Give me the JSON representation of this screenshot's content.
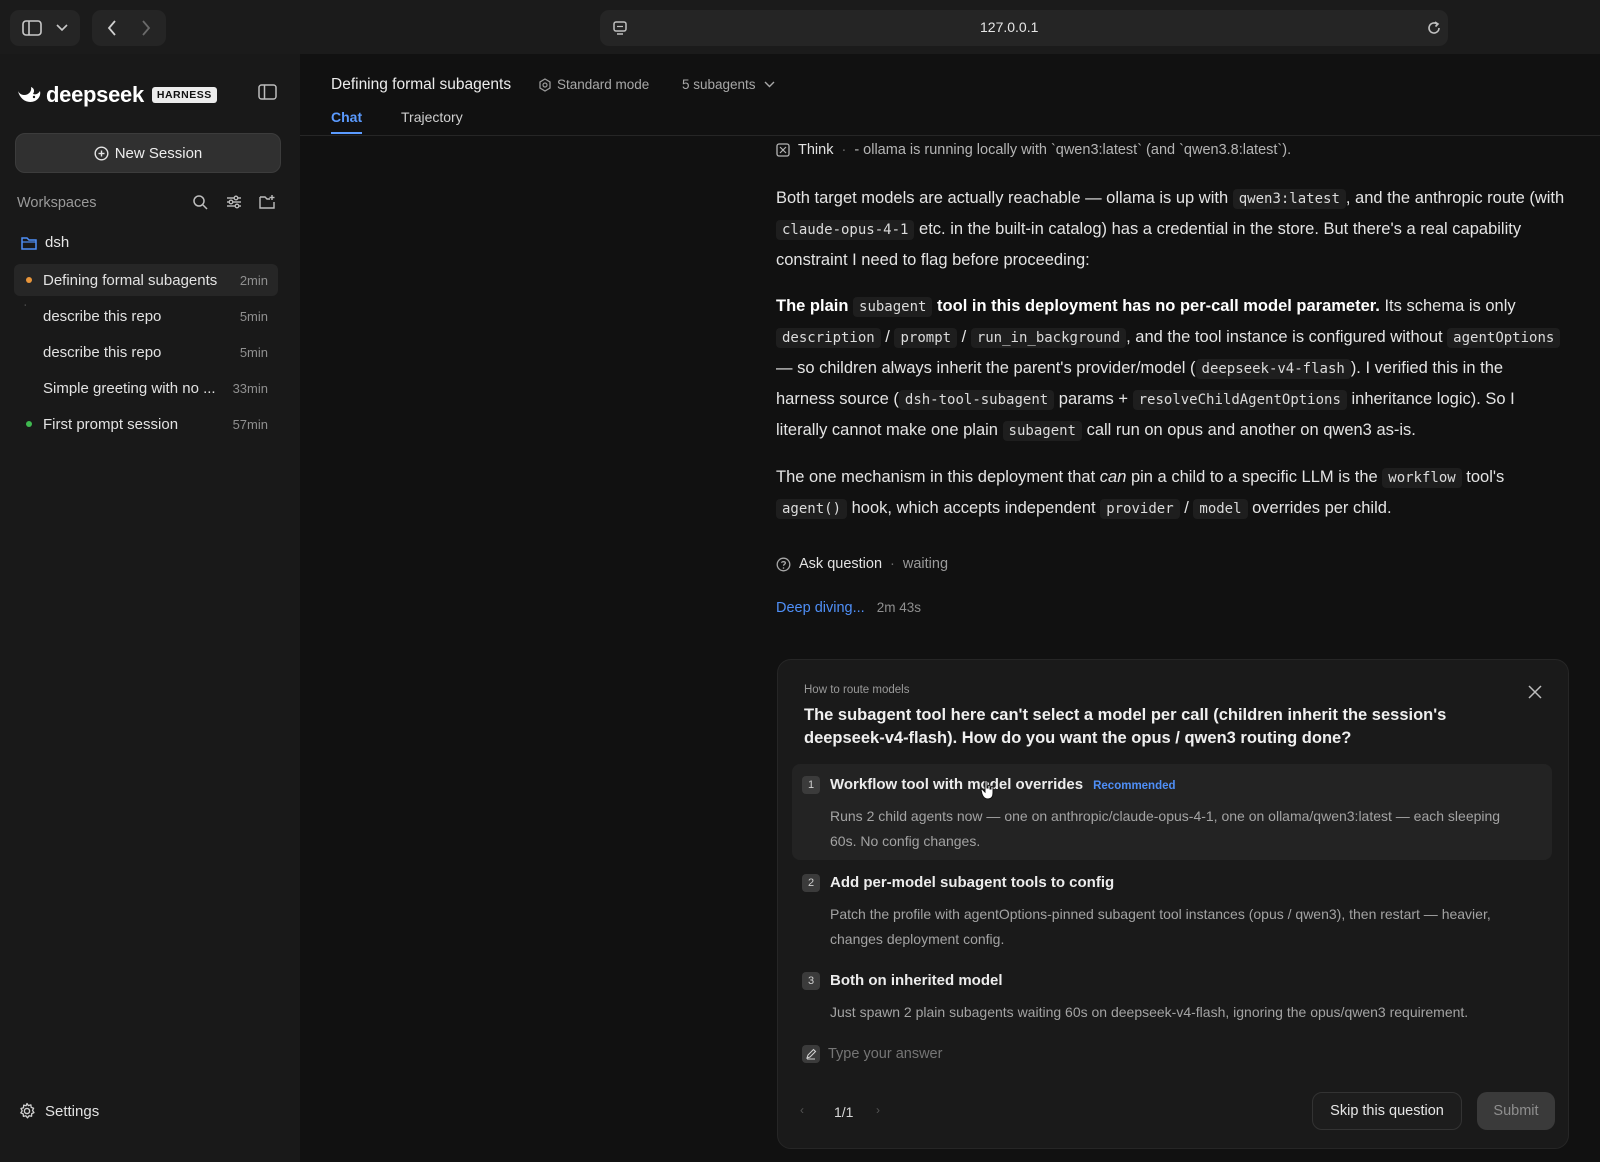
{
  "browser": {
    "url": "127.0.0.1"
  },
  "sidebar": {
    "brand": "deepseek",
    "badge": "HARNESS",
    "new_session": "New Session",
    "workspaces_label": "Workspaces",
    "workspace": "dsh",
    "sessions": [
      {
        "label": "Defining formal subagents",
        "time": "2min",
        "status": "running",
        "active": true
      },
      {
        "label": "describe this repo",
        "time": "5min",
        "status": "idle-mark",
        "active": false
      },
      {
        "label": "describe this repo",
        "time": "5min",
        "status": "none",
        "active": false
      },
      {
        "label": "Simple greeting with no ...",
        "time": "33min",
        "status": "none",
        "active": false
      },
      {
        "label": "First prompt session",
        "time": "57min",
        "status": "done",
        "active": false
      }
    ],
    "settings": "Settings"
  },
  "header": {
    "title": "Defining formal subagents",
    "mode": "Standard mode",
    "subagents": "5 subagents",
    "tabs": [
      "Chat",
      "Trajectory"
    ],
    "active_tab": "Chat"
  },
  "chat": {
    "think": {
      "label": "Think",
      "sep": "·",
      "text": "- ollama is running locally with `qwen3:latest` (and `qwen3.8:latest`)."
    },
    "p1": {
      "t1": "Both target models are actually reachable — ollama is up with ",
      "c1": "qwen3:latest",
      "t2": ", and the anthropic route (with ",
      "c2": "claude-opus-4-1",
      "t3": " etc. in the built-in catalog) has a credential in the store. But there's a real capability constraint I need to flag before proceeding:"
    },
    "p2": {
      "b1": "The plain ",
      "c1": "subagent",
      "b2": " tool in this deployment has no per-call model parameter.",
      "t1": " Its schema is only ",
      "c2": "description",
      "s1": " / ",
      "c3": "prompt",
      "s2": " / ",
      "c4": "run_in_background",
      "t2": ", and the tool instance is configured without ",
      "c5": "agentOptions",
      "t3": " — so children always inherit the parent's provider/model (",
      "c6": "deepseek-v4-flash",
      "t4": "). I verified this in the harness source (",
      "c7": "dsh-tool-subagent",
      "t5": " params + ",
      "c8": "resolveChildAgentOptions",
      "t6": " inheritance logic). So I literally cannot make one plain ",
      "c9": "subagent",
      "t7": " call run on opus and another on qwen3 as-is."
    },
    "p3": {
      "t1": "The one mechanism in this deployment that ",
      "i1": "can",
      "t2": " pin a child to a specific LLM is the ",
      "c1": "workflow",
      "t3": " tool's ",
      "c2": "agent()",
      "t4": " hook, which accepts independent ",
      "c3": "provider",
      "s1": " / ",
      "c4": "model",
      "t5": " overrides per child."
    },
    "ask": {
      "label": "Ask question",
      "sep": "·",
      "status": "waiting"
    },
    "progress": {
      "label": "Deep diving...",
      "elapsed": "2m 43s"
    }
  },
  "question": {
    "eyebrow": "How to route models",
    "text": "The subagent tool here can't select a model per call (children inherit the session's deepseek-v4-flash). How do you want the opus / qwen3 routing done?",
    "options": [
      {
        "num": "1",
        "title": "Workflow tool with model overrides",
        "tag": "Recommended",
        "desc": "Runs 2 child agents now — one on anthropic/claude-opus-4-1, one on ollama/qwen3:latest — each sleeping 60s. No config changes."
      },
      {
        "num": "2",
        "title": "Add per-model subagent tools to config",
        "tag": "",
        "desc": "Patch the profile with agentOptions-pinned subagent tool instances (opus / qwen3), then restart — heavier, changes deployment config."
      },
      {
        "num": "3",
        "title": "Both on inherited model",
        "tag": "",
        "desc": "Just spawn 2 plain subagents waiting 60s on deepseek-v4-flash, ignoring the opus/qwen3 requirement."
      }
    ],
    "answer_placeholder": "Type your answer",
    "pager": "1/1",
    "skip": "Skip this question",
    "submit": "Submit"
  },
  "colors": {
    "accent_blue": "#4f8ff7",
    "running_dot": "#e8953a",
    "done_dot": "#3fb950"
  }
}
